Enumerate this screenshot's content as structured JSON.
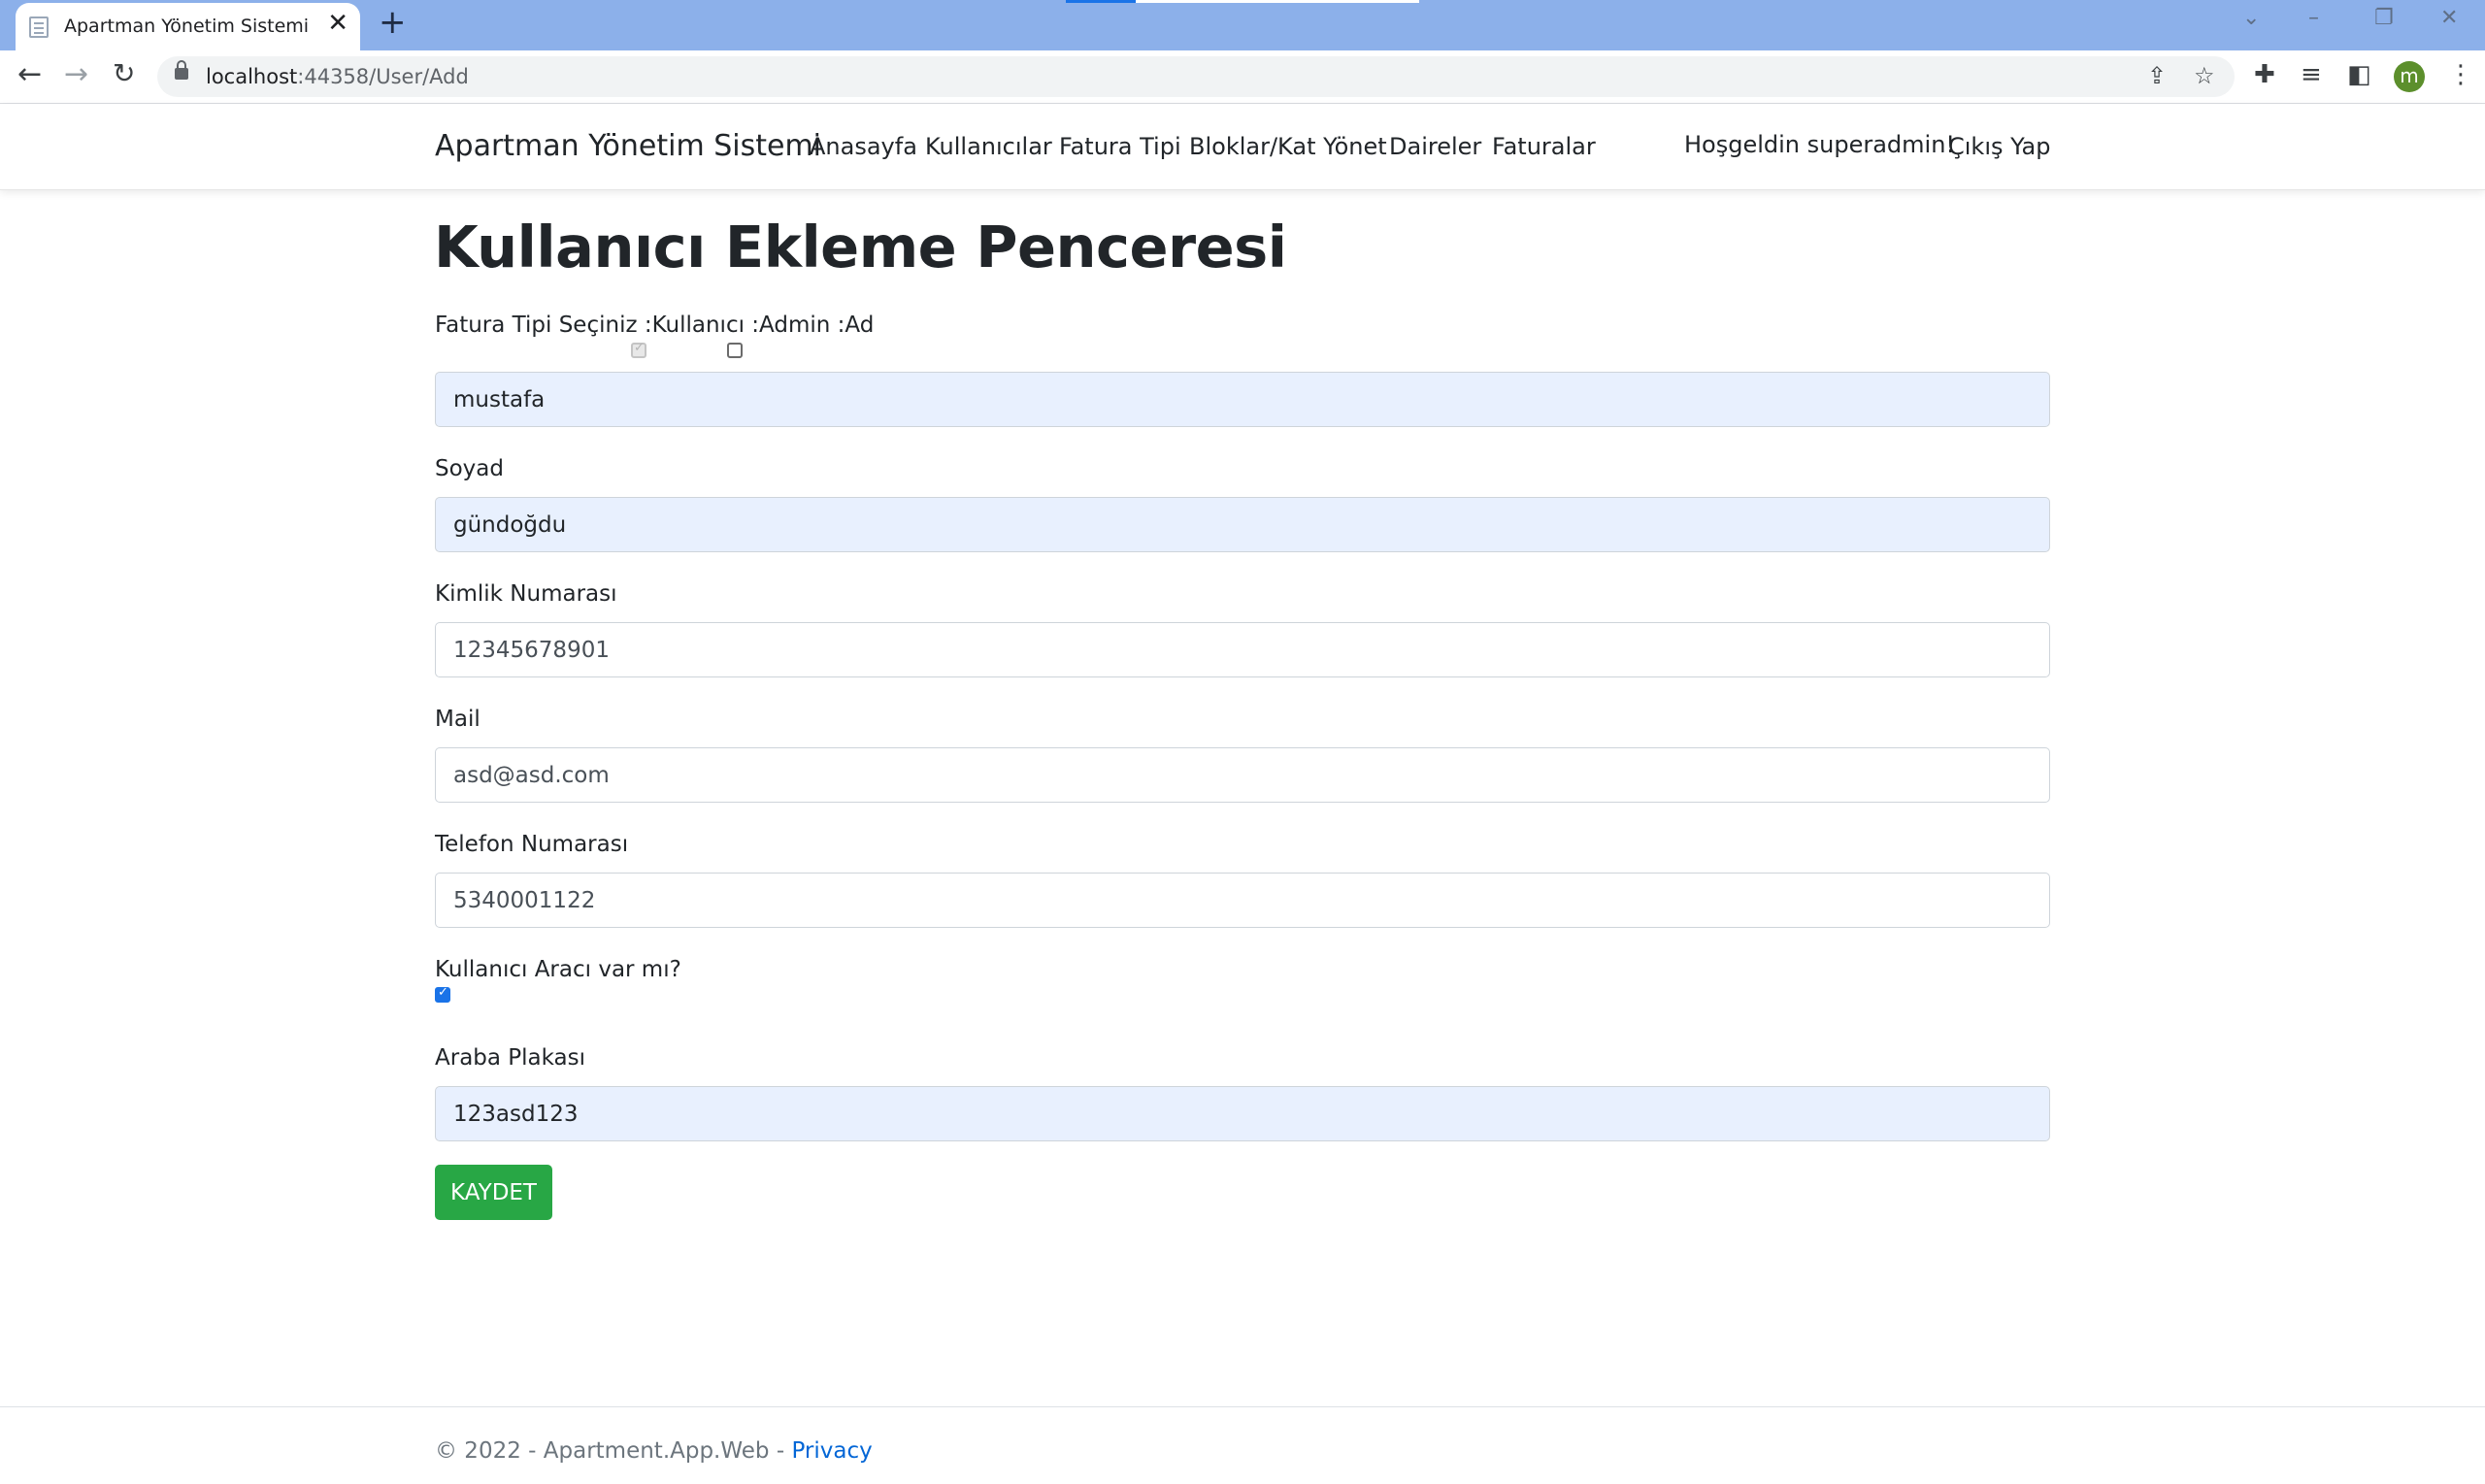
{
  "browser": {
    "tab_title": "Apartman Yönetim Sistemi",
    "tab_close": "✕",
    "new_tab": "+",
    "url_host": "localhost",
    "url_port_path": ":44358/User/Add",
    "window_controls": {
      "dropdown": "⌄",
      "minimize": "–",
      "restore": "❐",
      "close": "✕"
    },
    "avatar_letter": "m",
    "icons": [
      "back-icon",
      "forward-icon",
      "reload-icon",
      "lock-icon",
      "share-icon",
      "star-icon",
      "extensions-icon",
      "media-icon",
      "sidepanel-icon",
      "menu-icon"
    ]
  },
  "navbar": {
    "brand": "Apartman Yönetim Sistemi",
    "links": [
      "Anasayfa",
      "Kullanıcılar",
      "Fatura Tipi",
      "Bloklar/Kat Yönet",
      "Daireler",
      "Faturalar"
    ],
    "greeting": "Hoşgeldin superadmin!",
    "logout": "Çıkış Yap"
  },
  "form": {
    "title": "Kullanıcı Ekleme Penceresi",
    "role_label": "Fatura Tipi Seçiniz :Kullanıcı :Admin :Ad",
    "role_user_checked": true,
    "role_user_disabled": true,
    "role_admin_checked": false,
    "first_name_value": "mustafa",
    "last_name_label": "Soyad",
    "last_name_value": "gündoğdu",
    "id_label": "Kimlik Numarası",
    "id_value": "12345678901",
    "mail_label": "Mail",
    "mail_value": "asd@asd.com",
    "phone_label": "Telefon Numarası",
    "phone_value": "5340001122",
    "has_car_label": "Kullanıcı Aracı var mı?",
    "has_car_checked": true,
    "plate_label": "Araba Plakası",
    "plate_value": "123asd123",
    "save_label": "KAYDET"
  },
  "footer": {
    "text": "© 2022 - Apartment.App.Web - ",
    "privacy": "Privacy"
  },
  "colors": {
    "titlebar": "#8cb0ea",
    "save_button": "#28a745",
    "autofill_bg": "#e8f0fe",
    "link": "#0366d6"
  }
}
